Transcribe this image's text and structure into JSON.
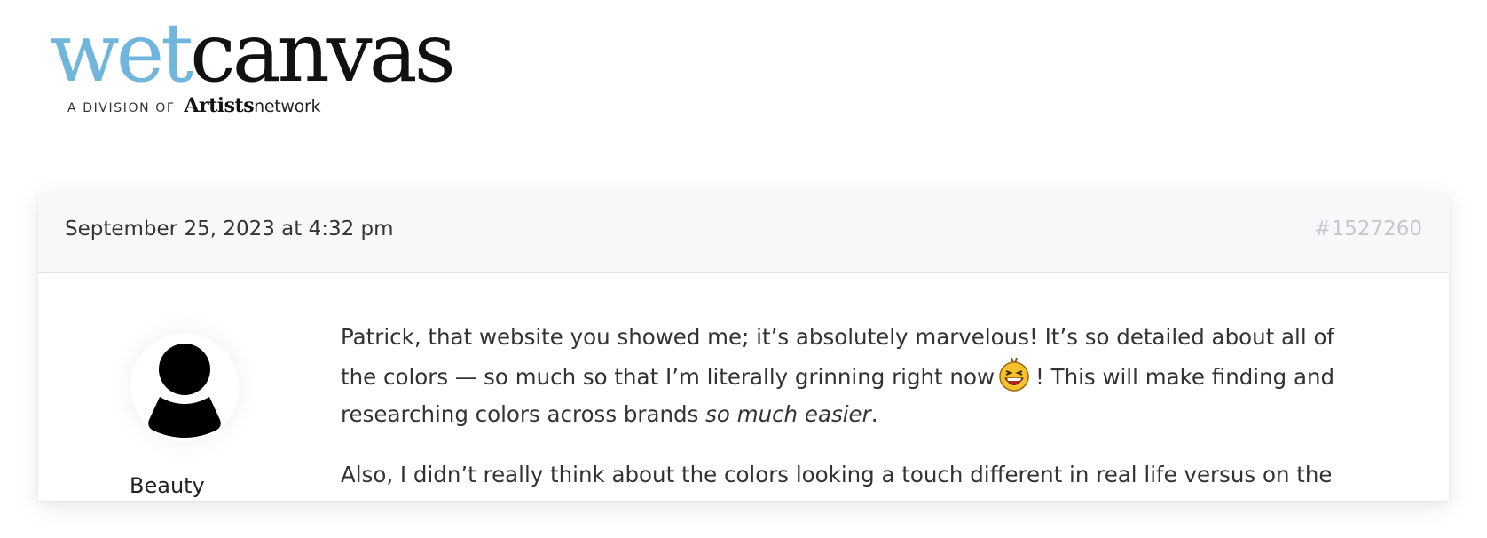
{
  "logo": {
    "wet": "wet",
    "canvas": "canvas",
    "division": "A DIVISION OF",
    "artists": "Artists",
    "network": "network"
  },
  "post": {
    "date": "September 25, 2023 at 4:32 pm",
    "id": "#1527260",
    "author": "Beauty",
    "paragraph1": {
      "part1": "Patrick, that website you showed me; it’s absolutely marvelous! It’s so detailed about all of the colors — so much so that I’m literally grinning right now",
      "part2": "! This will make finding and researching colors across brands",
      "emphasis": "so much easier",
      "end": "."
    },
    "paragraph2": "Also, I didn’t really think about the colors looking a touch different in real life versus on the"
  },
  "icons": {
    "avatar": "user-silhouette-icon",
    "emoji": "laughing-emoji-icon"
  },
  "colors": {
    "logo_wet": "#6fb5dc",
    "logo_canvas": "#111111",
    "header_bg": "#f7f8fa",
    "post_id": "#c4c8cf"
  }
}
